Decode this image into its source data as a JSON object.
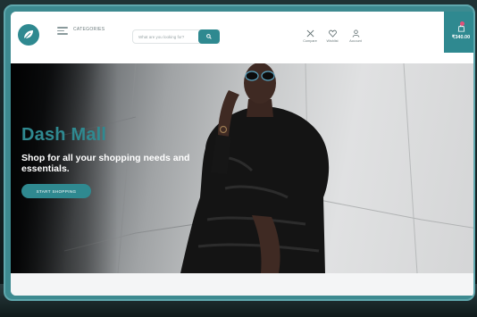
{
  "header": {
    "categories_label": "CATEGORIES",
    "search_placeholder": "What are you looking for?",
    "nav": {
      "compare_label": "Compare",
      "wishlist_label": "Wishlist",
      "account_label": "Account"
    },
    "cart_total": "₹340.00"
  },
  "hero": {
    "title": "Dash Mall",
    "subtitle": "Shop for all your shopping needs and essentials.",
    "cta_label": "START SHOPPING"
  },
  "icons": {
    "logo": "leaf-logo-icon",
    "menu": "hamburger-menu-icon",
    "search": "search-icon",
    "compare": "compare-arrows-icon",
    "wishlist": "heart-icon",
    "account": "user-icon",
    "cart": "shopping-bag-icon"
  },
  "colors": {
    "accent": "#2f8990",
    "frame": "#3d8a90",
    "badge": "#e0527a"
  }
}
